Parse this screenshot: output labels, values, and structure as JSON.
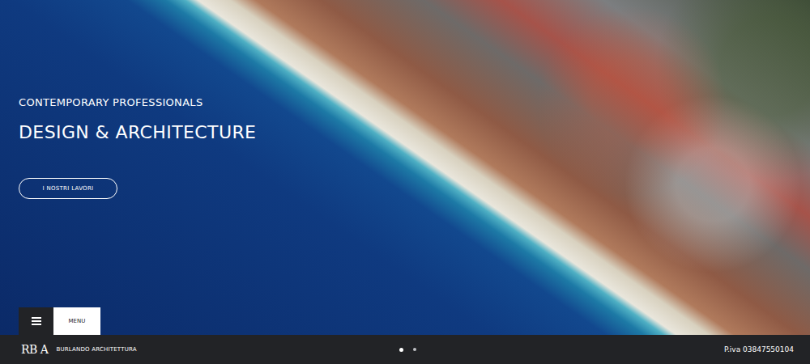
{
  "hero": {
    "subtitle": "CONTEMPORARY PROFESSIONALS",
    "title": "DESIGN & ARCHITECTURE",
    "button": "I NOSTRI LAVORI"
  },
  "menu": {
    "label": "MENU"
  },
  "slider": {
    "dots": [
      {
        "selected": true
      },
      {
        "selected": false
      }
    ]
  },
  "footer": {
    "logo": "RB A",
    "brand": "BURLANDO ARCHITETTURA",
    "vat": "P.iva 03847550104"
  }
}
